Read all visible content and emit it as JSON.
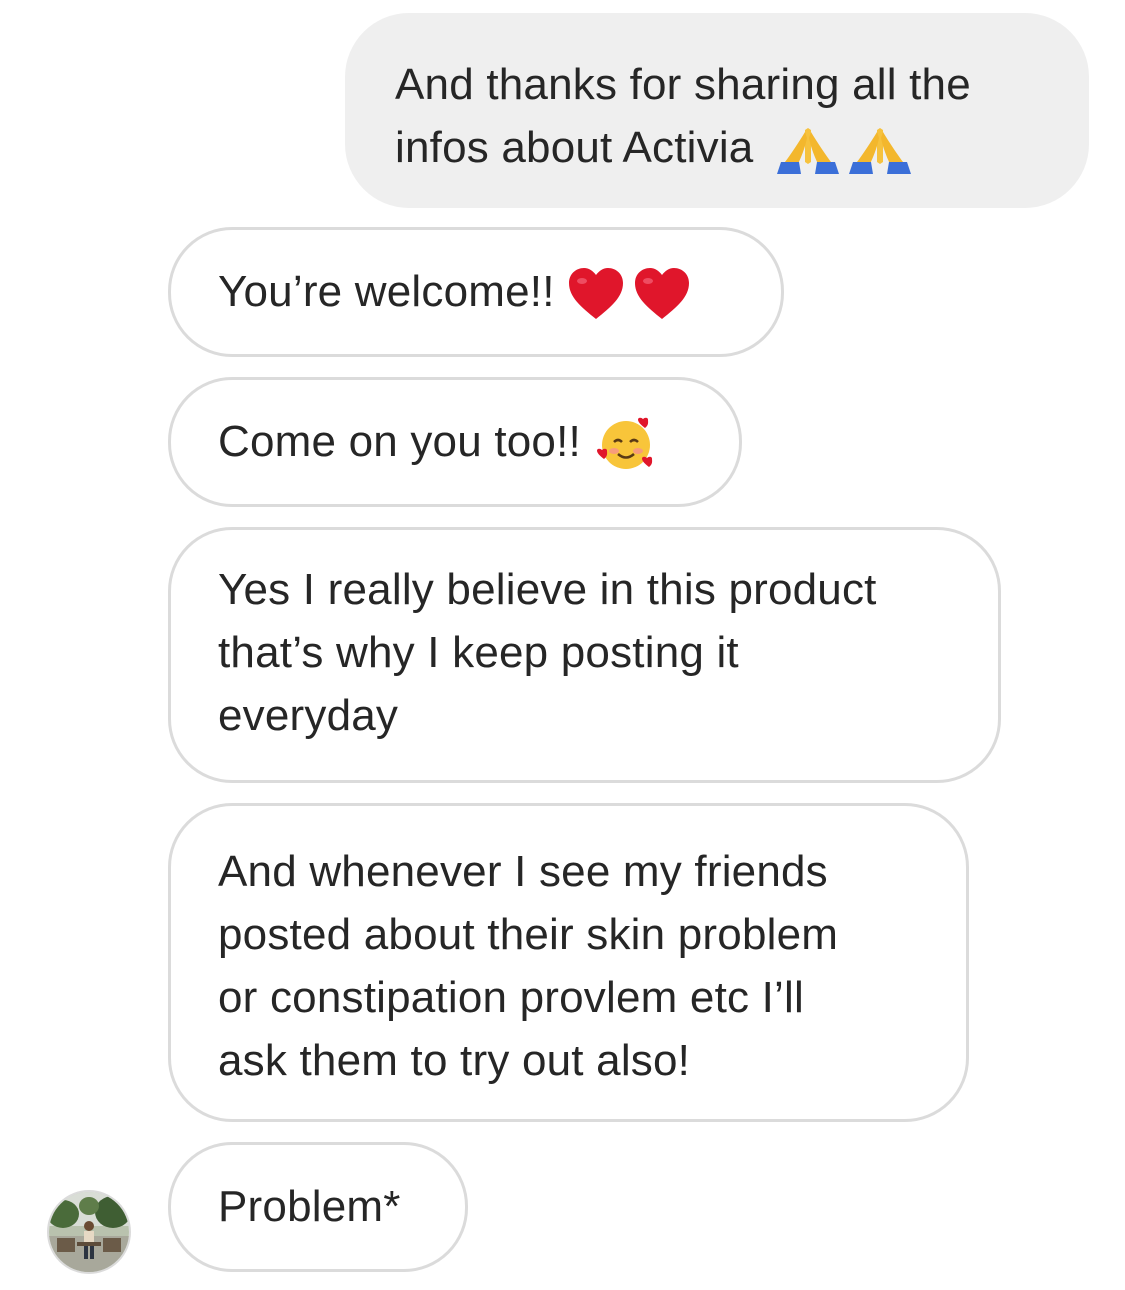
{
  "conversation": {
    "messages": [
      {
        "sender": "me",
        "lines": [
          "And thanks for sharing all the",
          "infos about Activia"
        ],
        "emoji": [
          "folded-hands",
          "folded-hands"
        ]
      },
      {
        "sender": "them",
        "lines": [
          "You’re welcome!!"
        ],
        "emoji": [
          "red-heart",
          "red-heart"
        ]
      },
      {
        "sender": "them",
        "lines": [
          "Come on you too!!"
        ],
        "emoji": [
          "smiling-face-with-hearts"
        ]
      },
      {
        "sender": "them",
        "lines": [
          "Yes I really believe in this product",
          "that’s why I keep posting it",
          "everyday"
        ]
      },
      {
        "sender": "them",
        "lines": [
          "And whenever I see my friends",
          "posted about their skin problem",
          "or constipation provlem etc I’ll",
          "ask them to try out also!"
        ]
      },
      {
        "sender": "them",
        "lines": [
          "Problem*"
        ],
        "show_avatar": true
      }
    ]
  },
  "theme": {
    "sent_bubble_bg": "#efefef",
    "received_border": "#dbdbdb",
    "text_color": "#262626",
    "heart_color": "#e0162b",
    "hands_color": "#f6c23e",
    "sleeve_color": "#3b6fd8"
  }
}
